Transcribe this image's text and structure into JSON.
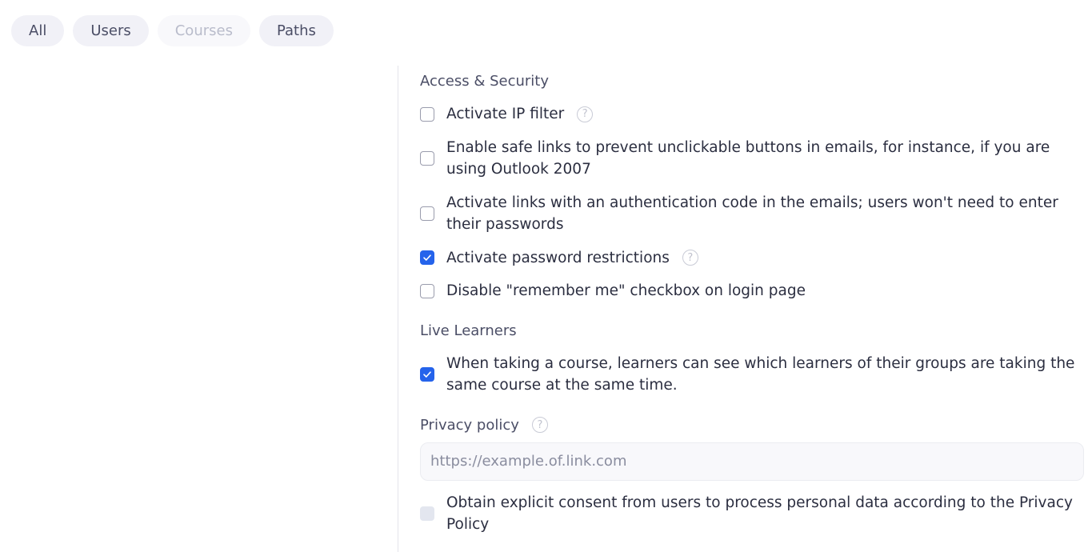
{
  "tabs": [
    {
      "label": "All",
      "disabled": false
    },
    {
      "label": "Users",
      "disabled": false
    },
    {
      "label": "Courses",
      "disabled": true
    },
    {
      "label": "Paths",
      "disabled": false
    }
  ],
  "access_security": {
    "title": "Access & Security",
    "options": [
      {
        "label": "Activate IP filter",
        "checked": false,
        "help": true
      },
      {
        "label": "Enable safe links to prevent unclickable buttons in emails, for instance, if you are using Outlook 2007",
        "checked": false,
        "help": false
      },
      {
        "label": "Activate links with an authentication code in the emails; users won't need to enter their passwords",
        "checked": false,
        "help": false
      },
      {
        "label": "Activate password restrictions",
        "checked": true,
        "help": true
      },
      {
        "label": "Disable \"remember me\" checkbox on login page",
        "checked": false,
        "help": false
      }
    ]
  },
  "live_learners": {
    "title": "Live Learners",
    "options": [
      {
        "label": "When taking a course, learners can see which learners of their groups are taking the same course at the same time.",
        "checked": true
      }
    ]
  },
  "privacy": {
    "label": "Privacy policy",
    "input_value": "",
    "input_placeholder": "https://example.of.link.com",
    "consent_label": "Obtain explicit consent from users to process personal data according to the Privacy Policy",
    "consent_checked": false,
    "consent_disabled": true
  },
  "icons": {
    "help": "?",
    "check": "checkmark-icon"
  },
  "colors": {
    "accent": "#2563eb",
    "tab_bg": "#f1f1f7",
    "divider": "#e4e5ea"
  }
}
